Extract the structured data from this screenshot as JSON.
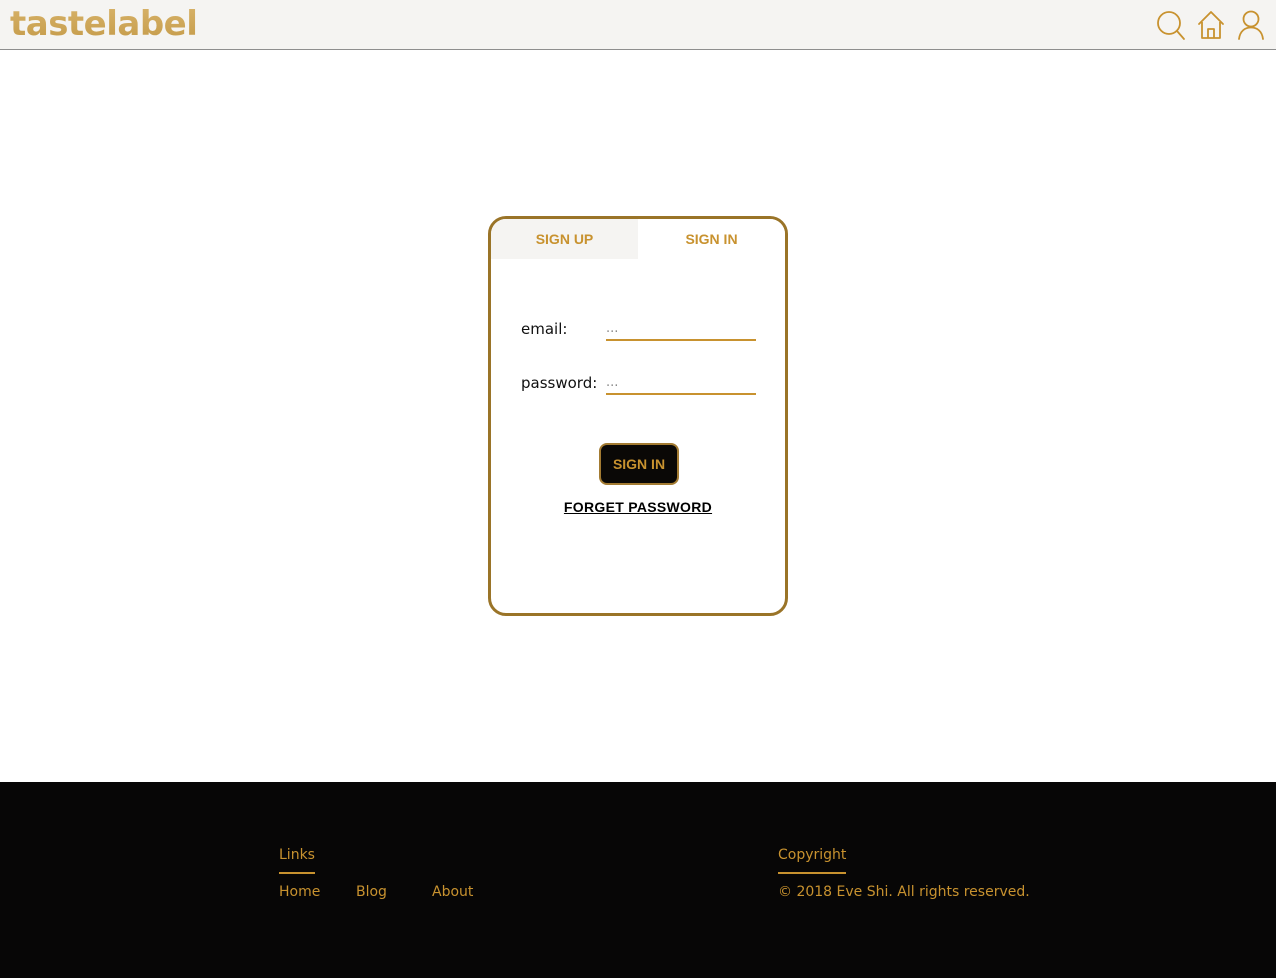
{
  "header": {
    "logo": "tastelabel",
    "icons": [
      "search-icon",
      "home-icon",
      "user-icon"
    ]
  },
  "auth": {
    "tabs": [
      {
        "label": "SIGN UP",
        "active": false
      },
      {
        "label": "SIGN IN",
        "active": true
      }
    ],
    "email_label": "email:",
    "email_placeholder": "...",
    "password_label": "password:",
    "password_placeholder": "...",
    "submit_label": "SIGN IN",
    "forget_label": "FORGET PASSWORD"
  },
  "footer": {
    "links_heading": "Links",
    "links": [
      "Home",
      "Blog",
      "About"
    ],
    "copyright_heading": "Copyright",
    "copyright_text": "© 2018 Eve Shi. All rights reserved."
  },
  "colors": {
    "accent": "#c8922f",
    "header_bg": "#f5f4f2",
    "footer_bg": "#070606"
  }
}
